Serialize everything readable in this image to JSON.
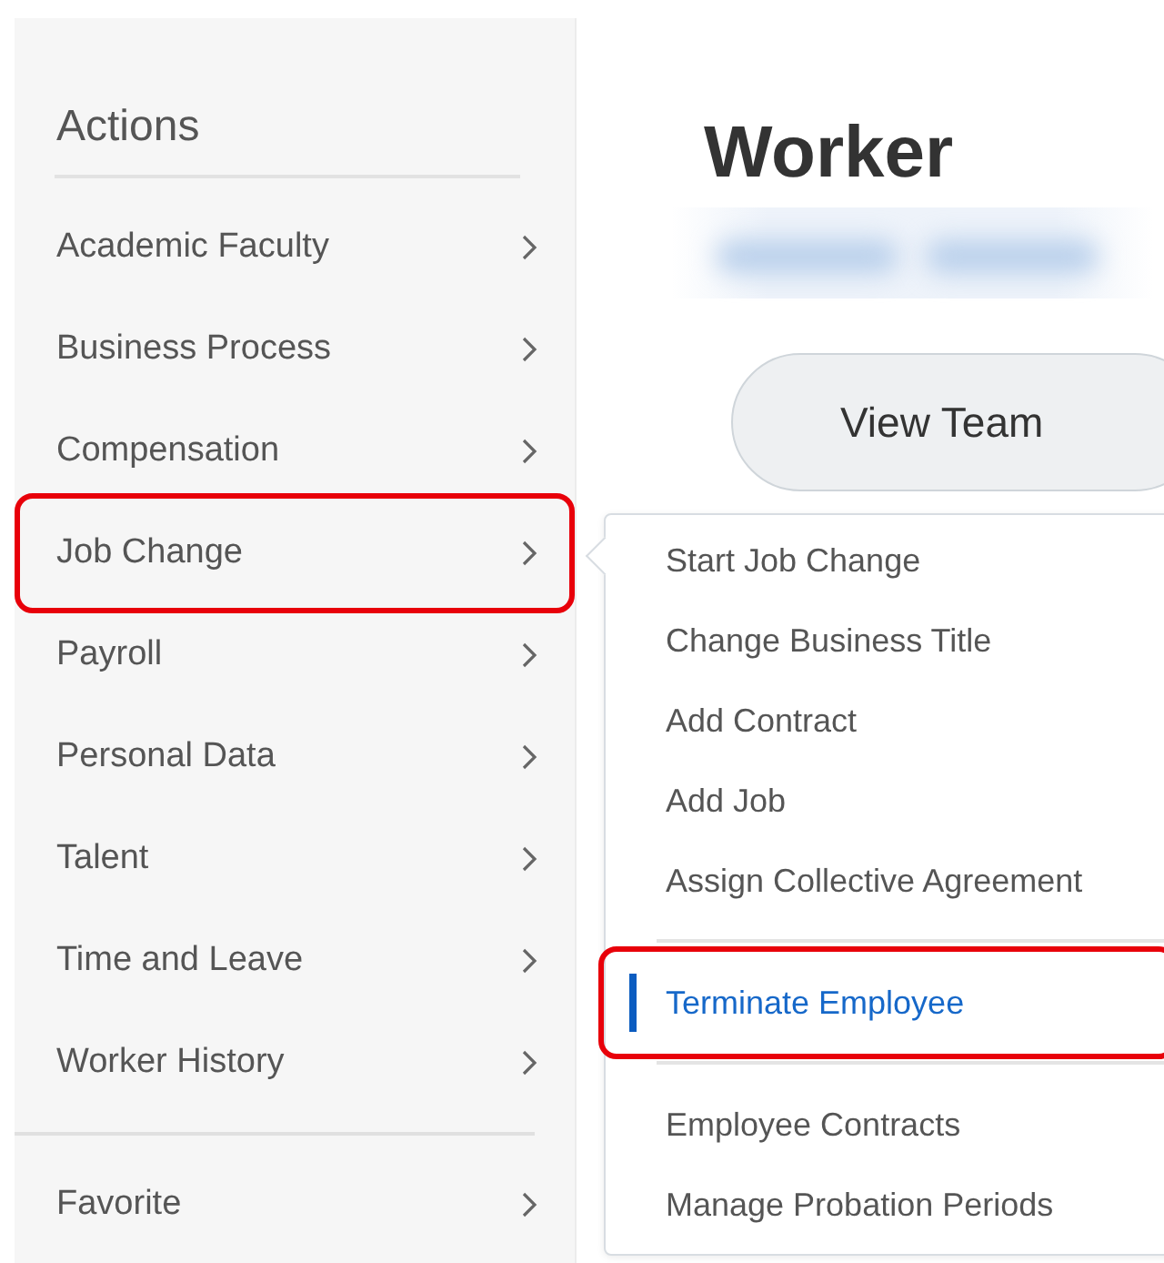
{
  "actions_panel": {
    "title": "Actions",
    "items": [
      {
        "label": "Academic Faculty",
        "highlighted": false
      },
      {
        "label": "Business Process",
        "highlighted": false
      },
      {
        "label": "Compensation",
        "highlighted": false
      },
      {
        "label": "Job Change",
        "highlighted": true
      },
      {
        "label": "Payroll",
        "highlighted": false
      },
      {
        "label": "Personal Data",
        "highlighted": false
      },
      {
        "label": "Talent",
        "highlighted": false
      },
      {
        "label": "Time and Leave",
        "highlighted": false
      },
      {
        "label": "Worker History",
        "highlighted": false
      }
    ],
    "footer_items": [
      {
        "label": "Favorite",
        "highlighted": false
      }
    ]
  },
  "worker": {
    "title": "Worker",
    "button": "View Team"
  },
  "submenu": {
    "groups": [
      [
        {
          "label": "Start Job Change",
          "selected": false,
          "highlighted": false
        },
        {
          "label": "Change Business Title",
          "selected": false,
          "highlighted": false
        },
        {
          "label": "Add Contract",
          "selected": false,
          "highlighted": false
        },
        {
          "label": "Add Job",
          "selected": false,
          "highlighted": false
        },
        {
          "label": "Assign Collective Agreement",
          "selected": false,
          "highlighted": false
        }
      ],
      [
        {
          "label": "Terminate Employee",
          "selected": true,
          "highlighted": true
        }
      ],
      [
        {
          "label": "Employee Contracts",
          "selected": false,
          "highlighted": false
        },
        {
          "label": "Manage Probation Periods",
          "selected": false,
          "highlighted": false
        }
      ]
    ]
  }
}
